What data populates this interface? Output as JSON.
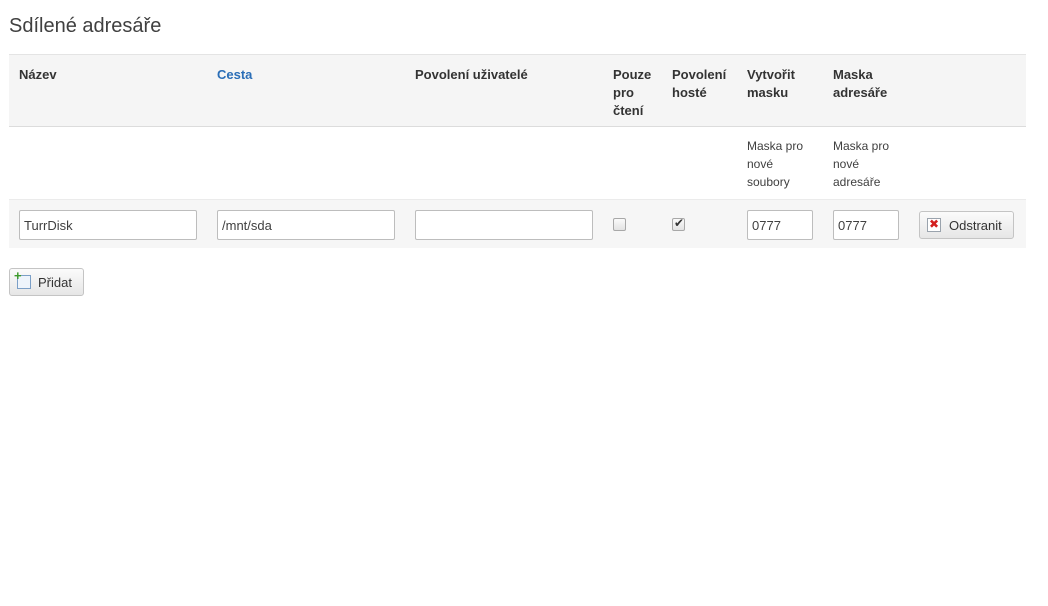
{
  "page": {
    "title": "Sdílené adresáře"
  },
  "table": {
    "headers": {
      "name": "Název",
      "path": "Cesta",
      "allowed_users": "Povolení uživatelé",
      "read_only": "Pouze pro čtení",
      "guests_allowed": "Povolení hosté",
      "create_mask": "Vytvořit masku",
      "directory_mask": "Maska adresáře"
    },
    "descriptions": {
      "create_mask": "Maska pro nové soubory",
      "directory_mask": "Maska pro nové adresáře"
    },
    "rows": [
      {
        "name": "TurrDisk",
        "path": "/mnt/sda",
        "allowed_users": "",
        "read_only": false,
        "guests_allowed": true,
        "create_mask": "0777",
        "directory_mask": "0777",
        "remove_label": "Odstranit"
      }
    ]
  },
  "actions": {
    "add_label": "Přidat"
  },
  "icons": {
    "remove": "remove-icon",
    "add": "add-icon",
    "check": "checkmark-icon"
  },
  "colors": {
    "link": "#2a6eb7",
    "header_bg": "#f5f5f5",
    "row_bg": "#f6f6f6"
  }
}
